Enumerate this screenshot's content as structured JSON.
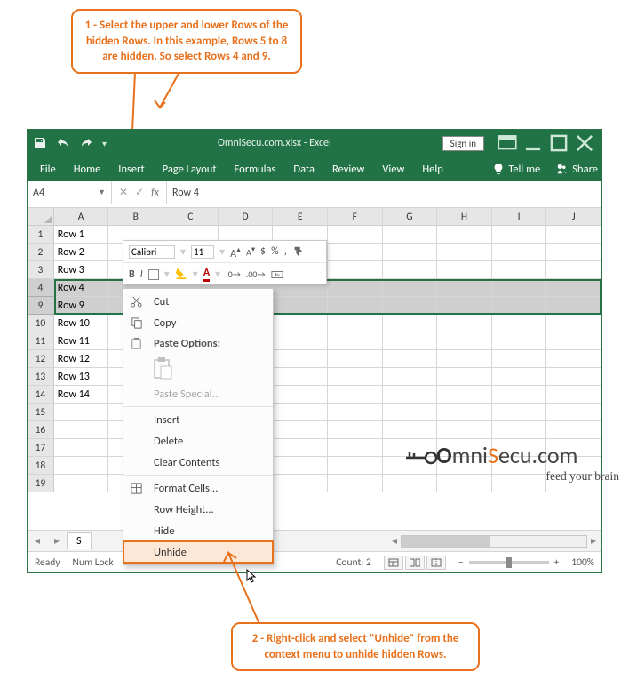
{
  "callout1": "1 - Select the upper and lower Rows of the hidden Rows. In this example, Rows 5 to 8 are hidden. So select Rows 4 and 9.",
  "callout2": "2 - Right-click and select \"Unhide\" from the context menu to unhide hidden Rows.",
  "titlebar": {
    "title": "OmniSecu.com.xlsx - Excel",
    "signin": "Sign in"
  },
  "ribbon": {
    "tabs": [
      "File",
      "Home",
      "Insert",
      "Page Layout",
      "Formulas",
      "Data",
      "Review",
      "View",
      "Help"
    ],
    "tellme": "Tell me",
    "share": "Share"
  },
  "namebox": "A4",
  "formula": "Row 4",
  "columns": [
    "A",
    "B",
    "C",
    "D",
    "E",
    "F",
    "G",
    "H",
    "I",
    "J"
  ],
  "rows": [
    {
      "n": "1",
      "v": "Row 1"
    },
    {
      "n": "2",
      "v": "Row 2"
    },
    {
      "n": "3",
      "v": "Row 3"
    },
    {
      "n": "4",
      "v": "Row 4",
      "sel": true,
      "active": true
    },
    {
      "n": "9",
      "v": "Row 9",
      "sel": true
    },
    {
      "n": "10",
      "v": "Row 10"
    },
    {
      "n": "11",
      "v": "Row 11"
    },
    {
      "n": "12",
      "v": "Row 12"
    },
    {
      "n": "13",
      "v": "Row 13"
    },
    {
      "n": "14",
      "v": "Row 14"
    },
    {
      "n": "15",
      "v": ""
    },
    {
      "n": "16",
      "v": ""
    },
    {
      "n": "17",
      "v": ""
    },
    {
      "n": "18",
      "v": ""
    },
    {
      "n": "19",
      "v": ""
    }
  ],
  "minitool": {
    "font": "Calibri",
    "size": "11"
  },
  "ctx": {
    "cut": "Cut",
    "copy": "Copy",
    "pasteopts": "Paste Options:",
    "pastespecial": "Paste Special...",
    "insert": "Insert",
    "delete": "Delete",
    "clear": "Clear Contents",
    "format": "Format Cells...",
    "rowh": "Row Height...",
    "hide": "Hide",
    "unhide": "Unhide"
  },
  "sheet": {
    "name": "S"
  },
  "status": {
    "ready": "Ready",
    "numlock": "Num Lock",
    "count": "Count: 2",
    "zoom": "100%",
    "plus": "+"
  },
  "logo": {
    "l1a": "O",
    "l1b": "mni",
    "l1c": "S",
    "l1d": "ecu",
    "l1e": ".com",
    "l2": "feed your brain"
  }
}
